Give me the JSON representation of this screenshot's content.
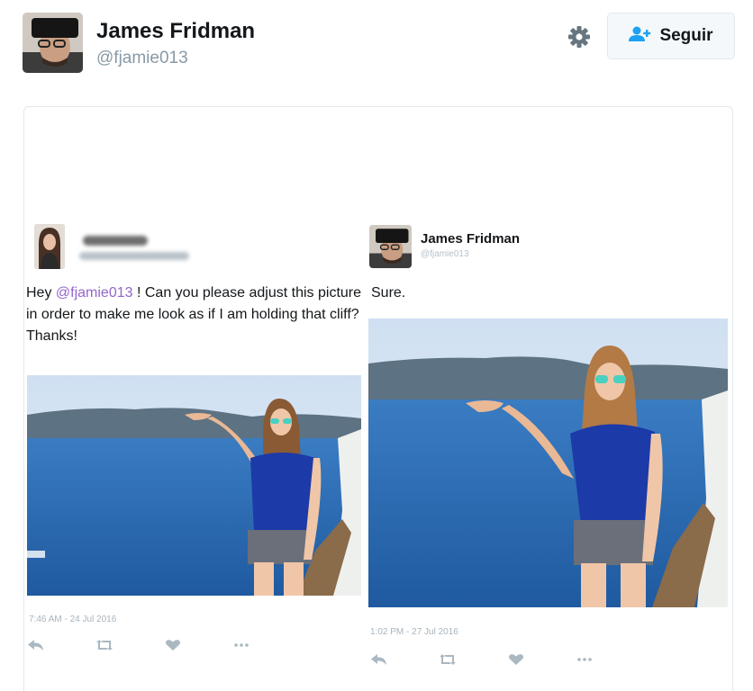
{
  "header": {
    "name": "James Fridman",
    "handle": "@fjamie013",
    "follow_label": "Seguir",
    "settings_icon": "gear-icon",
    "follow_icon": "add-user-icon"
  },
  "left_tweet": {
    "mention": "@fjamie013",
    "text_before": "Hey ",
    "text_after": " ! Can you please adjust this picture in order to make me look as if I am holding that cliff? Thanks!",
    "timestamp": "7:46 AM - 24 Jul 2016",
    "actions": [
      "reply-icon",
      "retweet-icon",
      "like-icon",
      "more-icon"
    ]
  },
  "right_tweet": {
    "name": "James Fridman",
    "handle": "@fjamie013",
    "text": "Sure.",
    "timestamp": "1:02 PM - 27 Jul 2016",
    "actions": [
      "reply-icon",
      "retweet-icon",
      "like-icon",
      "more-icon"
    ]
  },
  "colors": {
    "mention": "#9266cc",
    "follow_icon": "#1da1f2",
    "muted": "#8899a6",
    "sea": "#2f6fb5",
    "sky": "#d9e8f6",
    "shirt": "#1c3aa8"
  }
}
